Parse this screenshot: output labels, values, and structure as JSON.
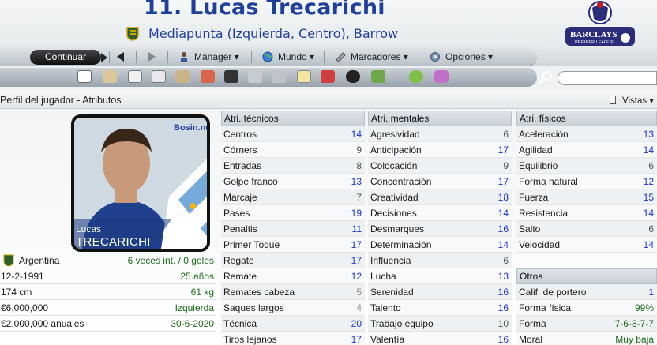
{
  "header": {
    "title": "11. Lucas Trecarichi",
    "subtitle": "Mediapunta (Izquierda, Centro), Barrow",
    "league_logo_text": "BARCLAYS",
    "league_logo_sub": "PREMIER LEAGUE"
  },
  "toolbar": {
    "continue_label": "Continuar",
    "manager_label": "Mánager",
    "world_label": "Mundo",
    "bookmarks_label": "Marcadores",
    "options_label": "Opciones"
  },
  "section": {
    "title": "Perfil del jugador - Atributos",
    "views_label": "Vistas"
  },
  "player_card": {
    "first_name": "Lucas",
    "last_name": "TRECARICHI",
    "site_logo_text": "Bosin.net"
  },
  "info": [
    {
      "label": "Argentina",
      "value": "6 veces int. / 0 goles"
    },
    {
      "label": "12-2-1991",
      "value": "25 años"
    },
    {
      "label": "174 cm",
      "value": "61 kg"
    },
    {
      "label": "€6,000,000",
      "value": "Izquierda"
    },
    {
      "label": "€2,000,000 anuales",
      "value": "30-6-2020"
    }
  ],
  "technical": {
    "header": "Atri. técnicos",
    "rows": [
      {
        "name": "Centros",
        "value": "14"
      },
      {
        "name": "Córners",
        "value": "9"
      },
      {
        "name": "Entradas",
        "value": "8"
      },
      {
        "name": "Golpe franco",
        "value": "13"
      },
      {
        "name": "Marcaje",
        "value": "7"
      },
      {
        "name": "Pases",
        "value": "19"
      },
      {
        "name": "Penaltis",
        "value": "11"
      },
      {
        "name": "Primer Toque",
        "value": "17"
      },
      {
        "name": "Regate",
        "value": "17"
      },
      {
        "name": "Remate",
        "value": "12"
      },
      {
        "name": "Remates cabeza",
        "value": "5"
      },
      {
        "name": "Saques largos",
        "value": "4"
      },
      {
        "name": "Técnica",
        "value": "20"
      },
      {
        "name": "Tiros lejanos",
        "value": "17"
      }
    ]
  },
  "mental": {
    "header": "Atri. mentales",
    "rows": [
      {
        "name": "Agresividad",
        "value": "6"
      },
      {
        "name": "Anticipación",
        "value": "17"
      },
      {
        "name": "Colocación",
        "value": "9"
      },
      {
        "name": "Concentración",
        "value": "17"
      },
      {
        "name": "Creatividad",
        "value": "18"
      },
      {
        "name": "Decisiones",
        "value": "14"
      },
      {
        "name": "Desmarques",
        "value": "16"
      },
      {
        "name": "Determinación",
        "value": "14"
      },
      {
        "name": "Influencia",
        "value": "6"
      },
      {
        "name": "Lucha",
        "value": "13"
      },
      {
        "name": "Serenidad",
        "value": "16"
      },
      {
        "name": "Talento",
        "value": "16"
      },
      {
        "name": "Trabajo equipo",
        "value": "10"
      },
      {
        "name": "Valentía",
        "value": "16"
      }
    ]
  },
  "physical": {
    "header": "Atri. físicos",
    "rows": [
      {
        "name": "Aceleración",
        "value": "13"
      },
      {
        "name": "Agilidad",
        "value": "14"
      },
      {
        "name": "Equilibrio",
        "value": "6"
      },
      {
        "name": "Forma natural",
        "value": "12"
      },
      {
        "name": "Fuerza",
        "value": "15"
      },
      {
        "name": "Resistencia",
        "value": "14"
      },
      {
        "name": "Salto",
        "value": "6"
      },
      {
        "name": "Velocidad",
        "value": "14"
      }
    ]
  },
  "other": {
    "header": "Otros",
    "rows": [
      {
        "name": "Calif. de portero",
        "value": "1"
      },
      {
        "name": "Forma física",
        "value": "99%"
      },
      {
        "name": "Forma",
        "value": "7-6-8-7-7"
      },
      {
        "name": "Moral",
        "value": "Muy baja"
      }
    ]
  },
  "colors": {
    "title_blue": "#1f3f9c",
    "value_blue": "#1c34d1",
    "value_green": "#1d6b1d"
  }
}
